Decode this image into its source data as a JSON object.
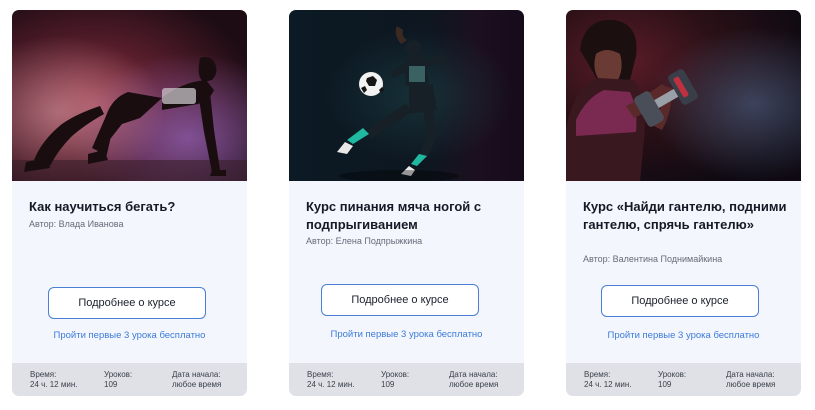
{
  "cards": [
    {
      "title": "Как научиться бегать?",
      "author": "Автор: Влада Иванова",
      "button": "Подробнее о курсе",
      "link": "Пройти первые 3 урока бесплатно",
      "time_label": "Время:",
      "time_value": "24 ч. 12 мин.",
      "lessons_label": "Уроков:",
      "lessons_value": "109",
      "start_label": "Дата начала:",
      "start_value": "любое время",
      "image": "runner-photo"
    },
    {
      "title": "Курс пинания мяча ногой с подпрыгиванием",
      "author": "Автор: Елена Подпрыжкина",
      "button": "Подробнее о курсе",
      "link": "Пройти первые 3 урока бесплатно",
      "time_label": "Время:",
      "time_value": "24 ч. 12 мин.",
      "lessons_label": "Уроков:",
      "lessons_value": "109",
      "start_label": "Дата начала:",
      "start_value": "любое время",
      "image": "soccer-photo"
    },
    {
      "title": "Курс «Найди гантелю, подними гантелю, спрячь гантелю»",
      "author": "Автор: Валентина Поднимайкина",
      "button": "Подробнее о курсе",
      "link": "Пройти первые 3 урока бесплатно",
      "time_label": "Время:",
      "time_value": "24 ч. 12 мин.",
      "lessons_label": "Уроков:",
      "lessons_value": "109",
      "start_label": "Дата начала:",
      "start_value": "любое время",
      "image": "dumbbell-photo"
    }
  ],
  "colors": {
    "card_bg": "#f3f6fc",
    "info_bg": "#dfe1e6",
    "accent": "#3d7bd9",
    "button_border": "#4a7fd4"
  }
}
